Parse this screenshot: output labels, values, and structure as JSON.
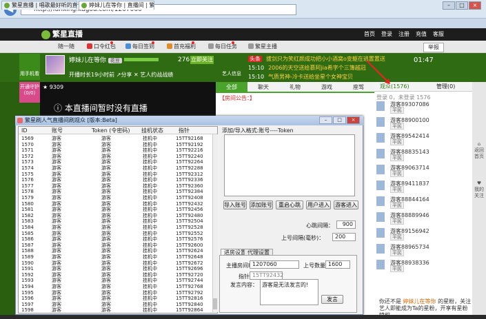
{
  "browser": {
    "url": "http://fanxing.kugou.com/1207060",
    "tabs": [
      {
        "label": "繁星直播 | 唱歌最好听的直播..."
      },
      {
        "label": "婷妹儿在等你 | 直播间 | 繁..."
      }
    ],
    "win_buttons": [
      "–",
      "□",
      "×"
    ]
  },
  "site": {
    "logo": "繁星直播",
    "nav": [
      "首页",
      "登录",
      "注册",
      "充值",
      "客服"
    ],
    "toolbar": [
      "随一随",
      "口令红包",
      "每日签到",
      "首充福利",
      "每日任务",
      "繁星主播"
    ],
    "report": "举报"
  },
  "host": {
    "name": "婷妹儿在等你",
    "level_badge": "花豆",
    "stats": "开播时长19小时前",
    "share": "分享",
    "artist_rank": "艺人约战战绩",
    "fans": "276",
    "follow": "立即关注",
    "mobile": "用手机看",
    "artist_info": "艺人信息",
    "guard": "开通守护(0/0)",
    "clock": "01:47"
  },
  "ticker": [
    {
      "time": "头条",
      "text": "拔剑只为笑红颜成功把小小酒窝o变躯在逃置置送"
    },
    {
      "time": "15:10",
      "text": "2006的天空送给慕阿jia希字个三簿越冠"
    },
    {
      "time": "15:10",
      "text": "气质男神-冷卡送给坐星个女神宝贝"
    }
  ],
  "stage": {
    "stars": "9309",
    "message": "本直播间暂时没有直播"
  },
  "chat": {
    "tabs": [
      "全部",
      "聊天",
      "礼物",
      "游戏",
      "座驾"
    ],
    "notice": "【房间公告：】"
  },
  "audience": {
    "tabs": [
      "观众(1576)",
      "管理(0)"
    ],
    "login_info": "登录 0，未登录 1576",
    "rank_label": "平民",
    "viewers": [
      "游客89307086",
      "游客88900100",
      "游客89542414",
      "游客88835143",
      "游客89063714",
      "游客89411837",
      "游客88844164",
      "游客88889946",
      "游客89156942",
      "游客88965734",
      "游客88938336"
    ],
    "bottom_text_prefix": "你还不是",
    "bottom_host": "婷妹儿在等你",
    "bottom_text_suffix": "的星粉，关注艺人即能成为Ta的星粉，开享有星粉特权。"
  },
  "sidebar": [
    "返回首页",
    "我的关注"
  ],
  "dialog": {
    "title": "繁星刷人气直播间刷观众 [版本:Beta]",
    "buttons": [
      "–",
      "□",
      "×"
    ],
    "grid_headers": [
      "ID",
      "账号",
      "Token (令密码)",
      "挂机状态",
      "指针"
    ],
    "rows": [
      [
        "1569",
        "游客",
        "游客",
        "挂机中",
        "15TT92168"
      ],
      [
        "1570",
        "游客",
        "游客",
        "挂机中",
        "15TT92192"
      ],
      [
        "1571",
        "游客",
        "游客",
        "挂机中",
        "15TT92216"
      ],
      [
        "1572",
        "游客",
        "游客",
        "挂机中",
        "15TT92240"
      ],
      [
        "1573",
        "游客",
        "游客",
        "挂机中",
        "15TT92264"
      ],
      [
        "1574",
        "游客",
        "游客",
        "挂机中",
        "15TT92288"
      ],
      [
        "1575",
        "游客",
        "游客",
        "挂机中",
        "15TT92312"
      ],
      [
        "1576",
        "游客",
        "游客",
        "挂机中",
        "15TT92336"
      ],
      [
        "1577",
        "游客",
        "游客",
        "挂机中",
        "15TT92360"
      ],
      [
        "1578",
        "游客",
        "游客",
        "挂机中",
        "15TT92384"
      ],
      [
        "1579",
        "游客",
        "游客",
        "挂机中",
        "15TT92408"
      ],
      [
        "1580",
        "游客",
        "游客",
        "挂机中",
        "15TT92432"
      ],
      [
        "1581",
        "游客",
        "游客",
        "挂机中",
        "15TT92456"
      ],
      [
        "1582",
        "游客",
        "游客",
        "挂机中",
        "15TT92480"
      ],
      [
        "1583",
        "游客",
        "游客",
        "挂机中",
        "15TT92504"
      ],
      [
        "1584",
        "游客",
        "游客",
        "挂机中",
        "15TT92528"
      ],
      [
        "1585",
        "游客",
        "游客",
        "挂机中",
        "15TT92552"
      ],
      [
        "1586",
        "游客",
        "游客",
        "挂机中",
        "15TT92576"
      ],
      [
        "1587",
        "游客",
        "游客",
        "挂机中",
        "15TT92600"
      ],
      [
        "1588",
        "游客",
        "游客",
        "挂机中",
        "15TT92624"
      ],
      [
        "1589",
        "游客",
        "游客",
        "挂机中",
        "15TT92648"
      ],
      [
        "1590",
        "游客",
        "游客",
        "挂机中",
        "15TT92672"
      ],
      [
        "1591",
        "游客",
        "游客",
        "挂机中",
        "15TT92696"
      ],
      [
        "1592",
        "游客",
        "游客",
        "挂机中",
        "15TT92720"
      ],
      [
        "1593",
        "游客",
        "游客",
        "挂机中",
        "15TT92744"
      ],
      [
        "1594",
        "游客",
        "游客",
        "挂机中",
        "15TT92768"
      ],
      [
        "1595",
        "游客",
        "游客",
        "挂机中",
        "15TT92792"
      ],
      [
        "1596",
        "游客",
        "游客",
        "挂机中",
        "15TT92816"
      ],
      [
        "1597",
        "游客",
        "游客",
        "挂机中",
        "15TT92840"
      ],
      [
        "1598",
        "游客",
        "游客",
        "挂机中",
        "15TT92864"
      ]
    ],
    "token_label": "添加/导入格式:账号----Token",
    "btn_import": "导入账号",
    "btn_add": "添加账号",
    "btn_relogin": "重启心跳",
    "btn_user_enter": "用户进入",
    "btn_guest_enter": "游客进入",
    "heartbeat_label": "心跳间隔：",
    "heartbeat_value": "900",
    "interval_label": "上号间隔(毫秒)：",
    "interval_value": "200",
    "inner_tabs": [
      "进房设置",
      "代理设置"
    ],
    "room_label": "主播房间ID：",
    "room_value": "1207060",
    "count_label": "上号数量：",
    "count_value": "1600",
    "pointer_label": "指针：",
    "pointer_value": "15TT92432",
    "msg_label": "发言内容：",
    "msg_value": "游客是无法发言的!",
    "send": "发言"
  }
}
